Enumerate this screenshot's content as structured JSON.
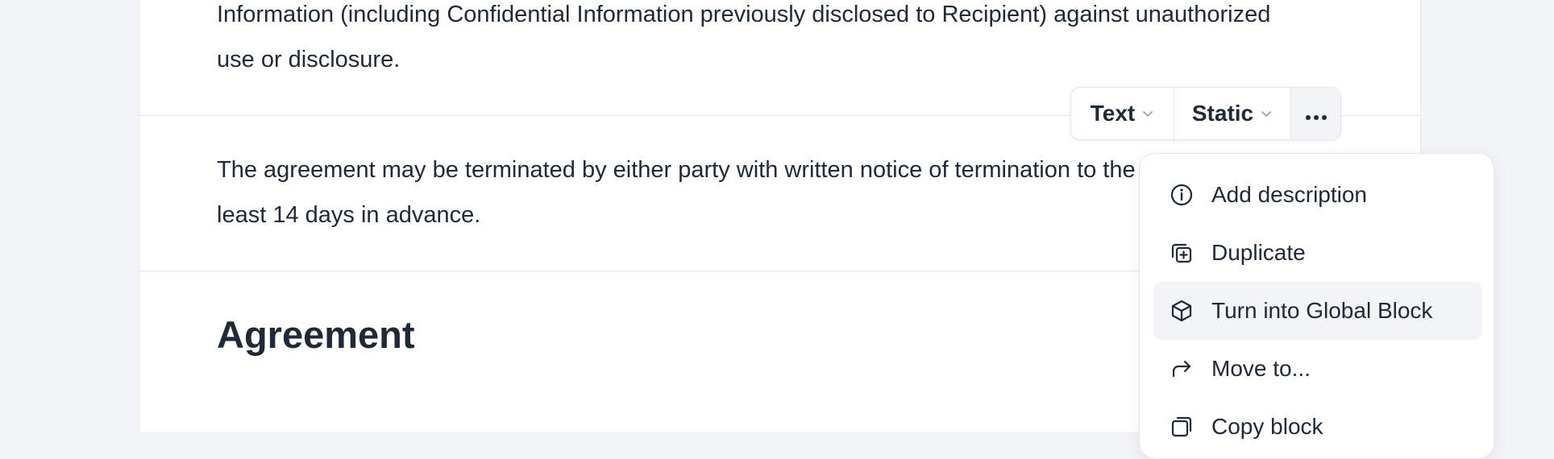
{
  "document": {
    "block1_text": "Information (including Confidential Information previously disclosed to Recipient) against unauthorized use or disclosure.",
    "block2_text": "The agreement may be terminated by either party with written notice of termination to the other party at least 14 days in advance.",
    "heading": "Agreement"
  },
  "toolbar": {
    "type_label": "Text",
    "mode_label": "Static",
    "more_icon": "ellipsis-icon"
  },
  "menu": {
    "items": [
      {
        "label": "Add description",
        "icon": "info-icon"
      },
      {
        "label": "Duplicate",
        "icon": "duplicate-icon"
      },
      {
        "label": "Turn into Global Block",
        "icon": "cube-icon",
        "active": true
      },
      {
        "label": "Move to...",
        "icon": "forward-arrow-icon"
      },
      {
        "label": "Copy block",
        "icon": "copy-icon"
      }
    ]
  }
}
